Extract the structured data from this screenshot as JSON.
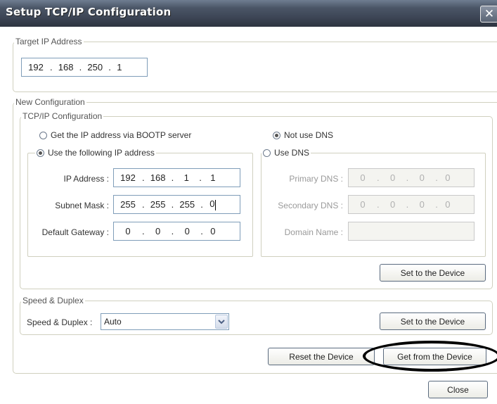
{
  "window": {
    "title": "Setup TCP/IP Configuration",
    "close_glyph": "✕"
  },
  "target": {
    "legend": "Target IP Address",
    "ip": [
      "192",
      "168",
      "250",
      "1"
    ]
  },
  "new_config": {
    "legend": "New Configuration",
    "tcpip": {
      "legend": "TCP/IP Configuration",
      "bootp_label": "Get the IP address via BOOTP server",
      "use_following_label": "Use the following IP address",
      "ip_label": "IP Address :",
      "ip": [
        "192",
        "168",
        "1",
        "1"
      ],
      "subnet_label": "Subnet Mask :",
      "subnet": [
        "255",
        "255",
        "255",
        "0"
      ],
      "gateway_label": "Default Gateway :",
      "gateway": [
        "0",
        "0",
        "0",
        "0"
      ],
      "not_use_dns_label": "Not use DNS",
      "use_dns_label": "Use DNS",
      "primary_dns_label": "Primary DNS :",
      "primary_dns": [
        "0",
        "0",
        "0",
        "0"
      ],
      "secondary_dns_label": "Secondary DNS :",
      "secondary_dns": [
        "0",
        "0",
        "0",
        "0"
      ],
      "domain_label": "Domain Name :",
      "domain": "",
      "set_button": "Set to the Device"
    },
    "speed": {
      "legend": "Speed & Duplex",
      "label": "Speed & Duplex :",
      "value": "Auto",
      "set_button": "Set to the Device"
    },
    "reset_button": "Reset the Device",
    "get_button": "Get from the Device"
  },
  "close_button": "Close"
}
